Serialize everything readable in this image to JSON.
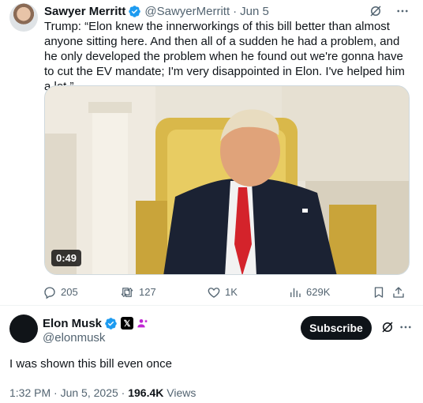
{
  "parent_tweet": {
    "author_name": "Sawyer Merritt",
    "author_handle": "@SawyerMerritt",
    "separator": "·",
    "date": "Jun 5",
    "text": "Trump: “Elon knew the innerworkings of this bill better than almost anyone sitting here. And then all of a sudden he had a problem, and he only developed the problem when he found out we're gonna have to cut the EV mandate; I'm very disappointed in Elon. I've helped him a lot.”",
    "video_duration": "0:49",
    "replies": "205",
    "reposts": "127",
    "likes": "1K",
    "views": "629K"
  },
  "main_tweet": {
    "author_name": "Elon Musk",
    "author_handle": "@elonmusk",
    "subscribe_label": "Subscribe",
    "text": "I was shown this bill even once",
    "time": "1:32 PM",
    "date": "Jun 5, 2025",
    "views_count": "196.4K",
    "views_label": "Views",
    "dot": "·"
  },
  "colors": {
    "verified_blue": "#1d9bf0",
    "muted_text": "#536471",
    "primary_text": "#0f1419",
    "subscribe_bg": "#0f1419",
    "affiliate_pink": "#c026d3"
  },
  "icons": [
    "verified-badge-icon",
    "grok-icon",
    "more-icon",
    "reply-icon",
    "repost-icon",
    "like-icon",
    "views-icon",
    "bookmark-icon",
    "share-icon",
    "x-badge-icon",
    "affiliate-icon"
  ]
}
